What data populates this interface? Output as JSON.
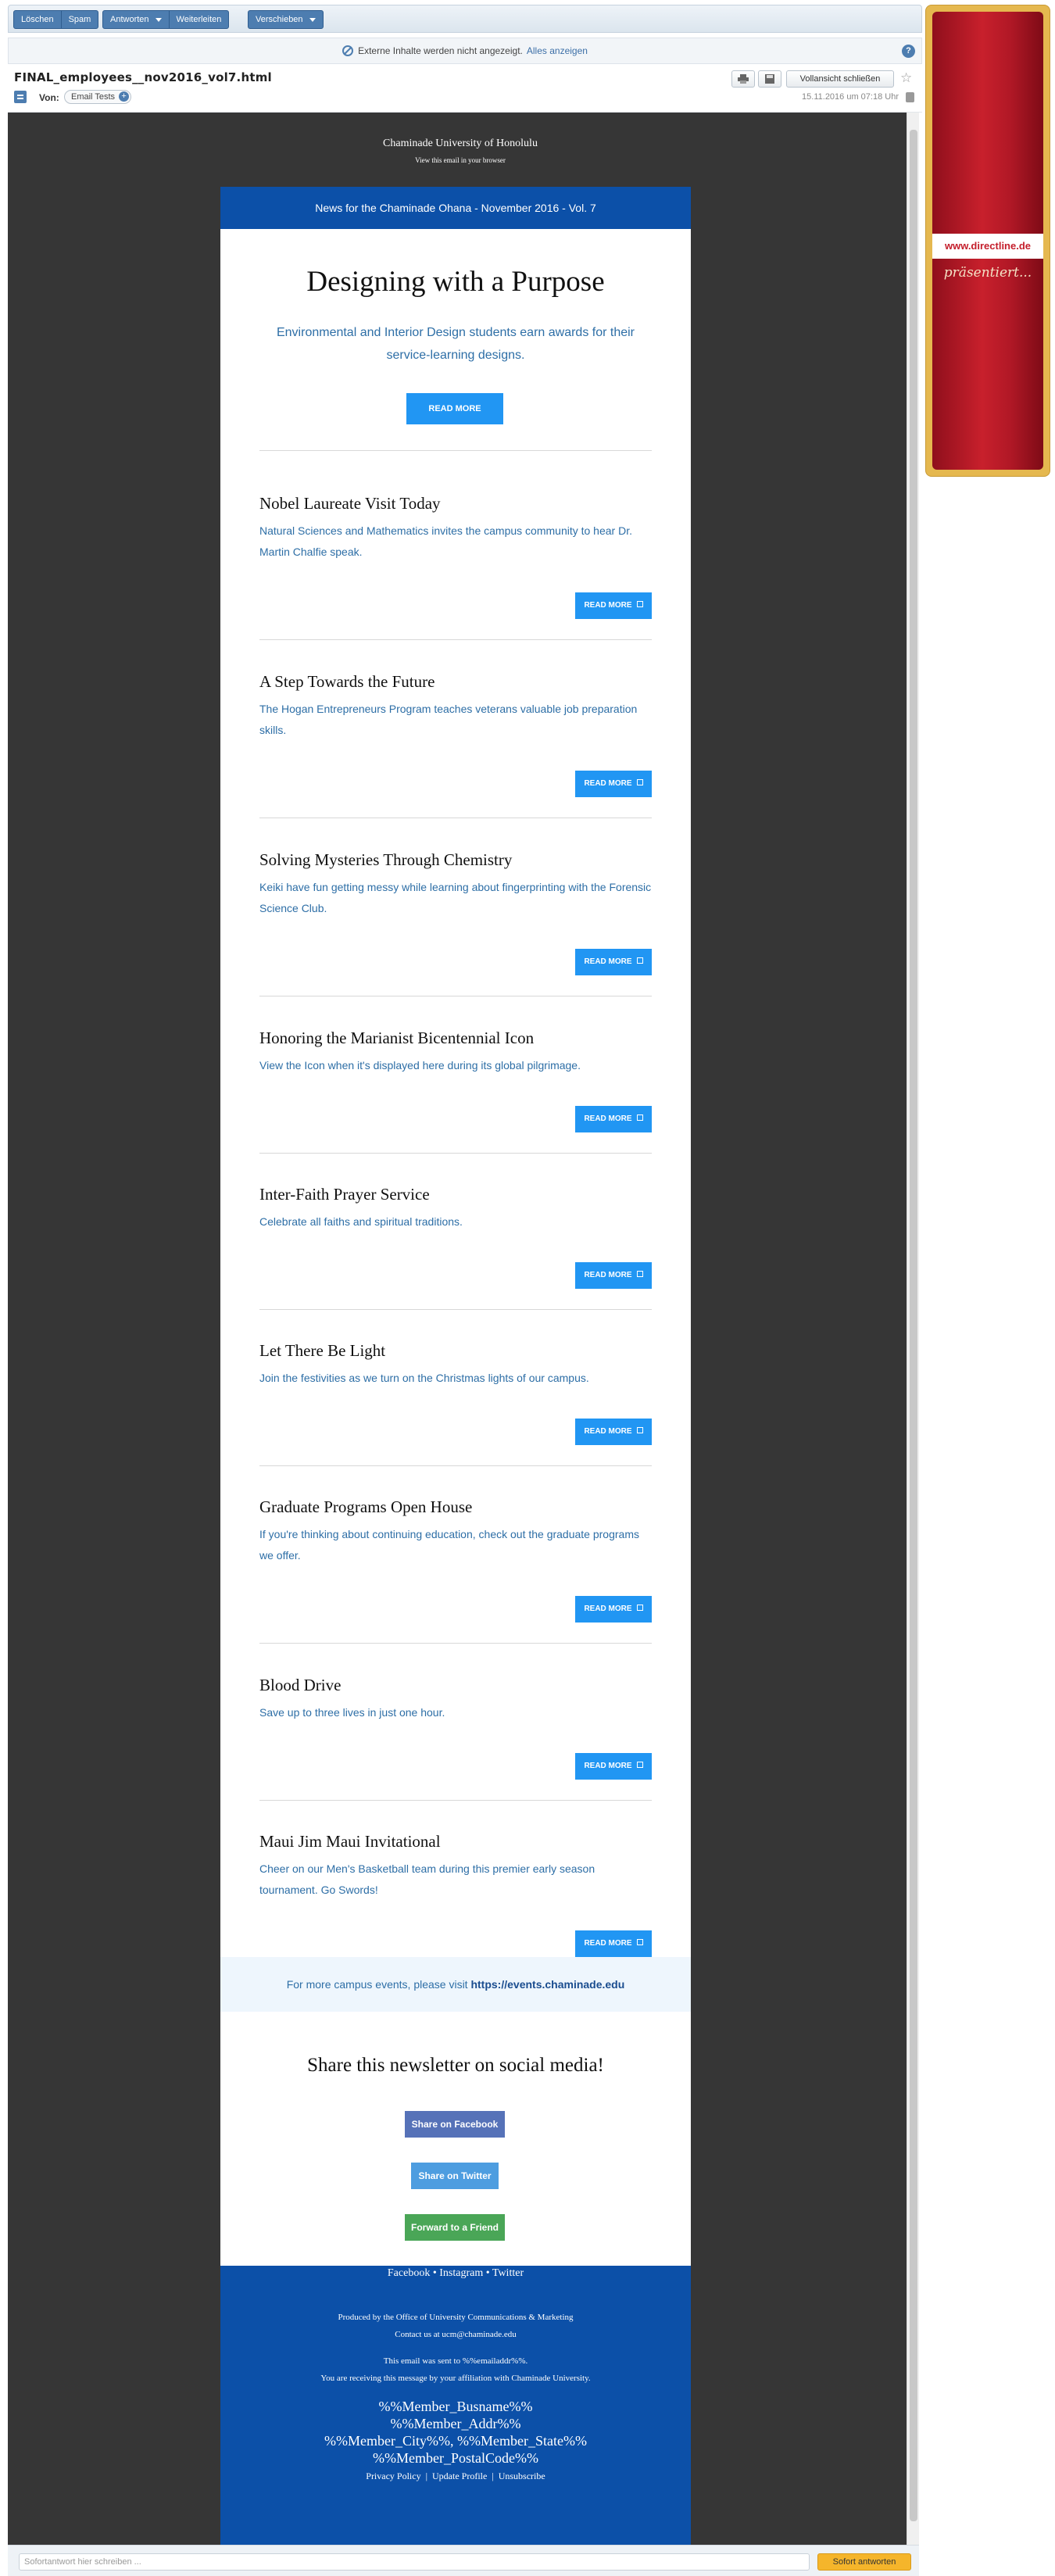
{
  "toolbar": {
    "delete": "Löschen",
    "spam": "Spam",
    "reply": "Antworten",
    "forward": "Weiterleiten",
    "move": "Verschieben"
  },
  "external_bar": {
    "message": "Externe Inhalte werden nicht angezeigt.",
    "show_all": "Alles anzeigen",
    "help": "?"
  },
  "message": {
    "subject": "FINAL_employees__nov2016_vol7.html",
    "close_fullscreen": "Vollansicht schließen",
    "from_label": "Von:",
    "from_name": "Email Tests",
    "date": "15.11.2016 um 07:18 Uhr"
  },
  "newsletter": {
    "org": "Chaminade University of Honolulu",
    "view_browser": "View this email in your browser",
    "header": "News for the Chaminade Ohana - November 2016 - Vol. 7",
    "hero": {
      "title": "Designing with a Purpose",
      "subtitle": "Environmental and Interior Design students earn awards for their service-learning designs.",
      "button": "READ MORE"
    },
    "read_more_label": "READ MORE",
    "articles": [
      {
        "title": "Nobel Laureate Visit Today",
        "desc": "Natural Sciences and Mathematics invites the campus community to hear Dr. Martin Chalfie speak."
      },
      {
        "title": "A Step Towards the Future",
        "desc": "The Hogan Entrepreneurs Program teaches veterans valuable job preparation skills."
      },
      {
        "title": "Solving Mysteries Through Chemistry",
        "desc": "Keiki have fun getting messy while learning about fingerprinting with the Forensic Science Club."
      },
      {
        "title": "Honoring the Marianist Bicentennial Icon",
        "desc": "View the Icon when it's displayed here during its global pilgrimage."
      },
      {
        "title": "Inter-Faith Prayer Service",
        "desc": "Celebrate all faiths and spiritual traditions."
      },
      {
        "title": "Let There Be Light",
        "desc": "Join the festivities as we turn on the Christmas lights of our campus."
      },
      {
        "title": "Graduate Programs Open House",
        "desc": "If you're thinking about continuing education, check out the graduate programs we offer."
      },
      {
        "title": "Blood Drive",
        "desc": "Save up to three lives in just one hour."
      },
      {
        "title": "Maui Jim Maui Invitational",
        "desc": "Cheer on our Men's Basketball team during this premier early season tournament. Go Swords!"
      }
    ],
    "events_text": "For more campus events, please visit",
    "events_link": "https://events.chaminade.edu",
    "share_title": "Share this newsletter on social media!",
    "share_facebook": "Share on Facebook",
    "share_twitter": "Share on Twitter",
    "forward_friend": "Forward to a Friend",
    "colors": {
      "facebook": "#5672b8",
      "twitter": "#4d9de0",
      "forward": "#4aa657",
      "brand": "#0c50a8",
      "button": "#2196f3"
    },
    "footer": {
      "social": [
        "Facebook",
        "Instagram",
        "Twitter"
      ],
      "produced": "Produced by the Office of University Communications & Marketing",
      "contact": "Contact us at ucm@chaminade.edu",
      "sent_to": "This email was sent to %%emailaddr%%.",
      "affiliation": "You are receiving this message by your affiliation with Chaminade University.",
      "member_busname": "%%Member_Busname%%",
      "member_addr": "%%Member_Addr%%",
      "member_city_state": "%%Member_City%%, %%Member_State%%",
      "member_postal": "%%Member_PostalCode%%",
      "links": [
        "Privacy Policy",
        "Update Profile",
        "Unsubscribe"
      ]
    }
  },
  "reply": {
    "placeholder": "Sofortantwort hier schreiben ...",
    "button": "Sofort antworten"
  },
  "ad": {
    "url": "www.directline.de",
    "tagline": "präsentiert..."
  }
}
